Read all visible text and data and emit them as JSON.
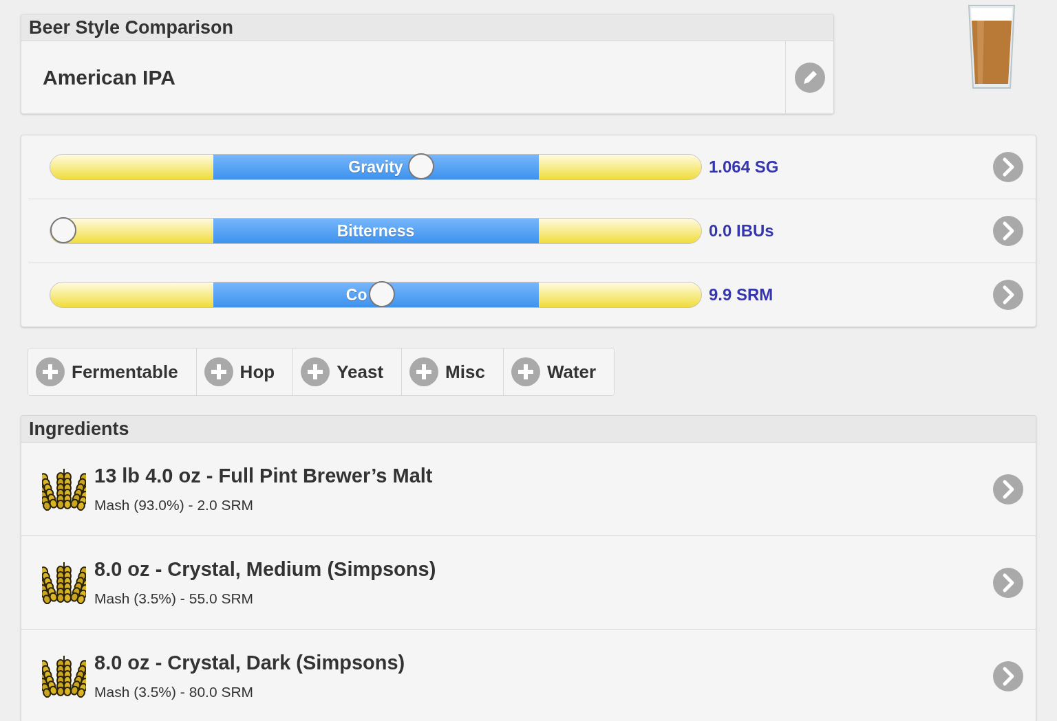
{
  "style_card": {
    "title": "Beer Style Comparison",
    "style_name": "American IPA"
  },
  "meters": [
    {
      "label": "Gravity",
      "level": 0.57,
      "reading": "1.064 SG"
    },
    {
      "label": "Bitterness",
      "level": 0.02,
      "reading": "0.0 IBUs"
    },
    {
      "label": "Co",
      "level": 0.51,
      "reading": "9.9 SRM"
    }
  ],
  "add_buttons": [
    "Fermentable",
    "Hop",
    "Yeast",
    "Misc",
    "Water"
  ],
  "ingredients": {
    "title": "Ingredients",
    "items": [
      {
        "name": "13 lb 4.0 oz - Full Pint Brewer’s Malt",
        "detail": "Mash (93.0%) - 2.0 SRM"
      },
      {
        "name": "8.0 oz - Crystal, Medium (Simpsons)",
        "detail": "Mash (3.5%) - 55.0 SRM"
      },
      {
        "name": "8.0 oz - Crystal, Dark (Simpsons)",
        "detail": "Mash (3.5%) - 80.0 SRM"
      }
    ]
  }
}
